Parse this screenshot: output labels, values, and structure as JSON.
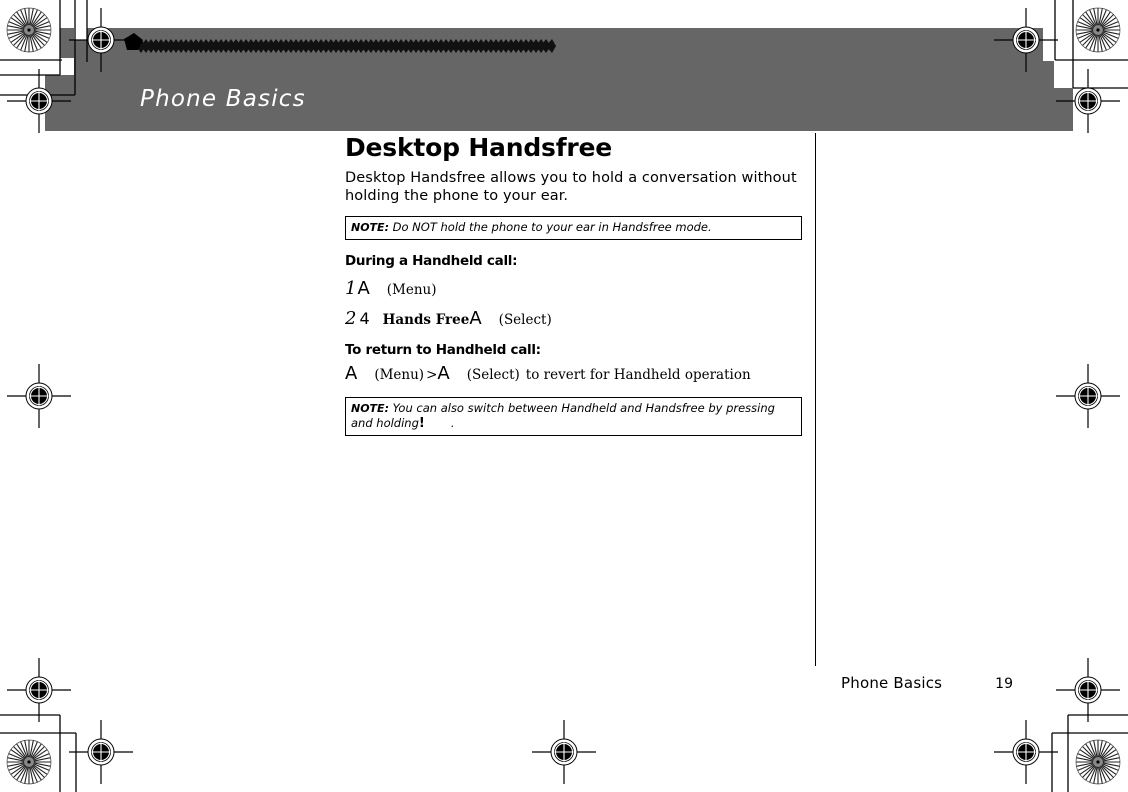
{
  "document": {
    "running_header": "Phone Basics",
    "footer_label": "Phone Basics",
    "page_number": "19",
    "banner_color": "#666666"
  },
  "content": {
    "heading": "Desktop Handsfree",
    "intro": "Desktop Handsfree allows you to hold a conversation without holding the phone to your ear.",
    "note_1": {
      "label": "NOTE:",
      "text": "Do NOT hold the phone to your ear in Handsfree mode."
    },
    "subheading_1": "During a Handheld call:",
    "steps": [
      {
        "number": "1",
        "key_glyph": "A",
        "caption": "(Menu)"
      },
      {
        "number": "2",
        "digit_key": "4",
        "menu_item": "Hands Free",
        "key_glyph": "A",
        "caption": "(Select)"
      }
    ],
    "subheading_2": "To return to Handheld call:",
    "revert": {
      "key_glyph_1": "A",
      "caption_1": "(Menu)",
      "separator": ">",
      "key_glyph_2": "A",
      "caption_2": "(Select)",
      "tail": "to revert for Handheld operation"
    },
    "note_2": {
      "label": "NOTE:",
      "text_before": "You can also switch between Handheld and Handsfree by pressing and holding",
      "key_glyph": "!",
      "text_after": "."
    }
  }
}
